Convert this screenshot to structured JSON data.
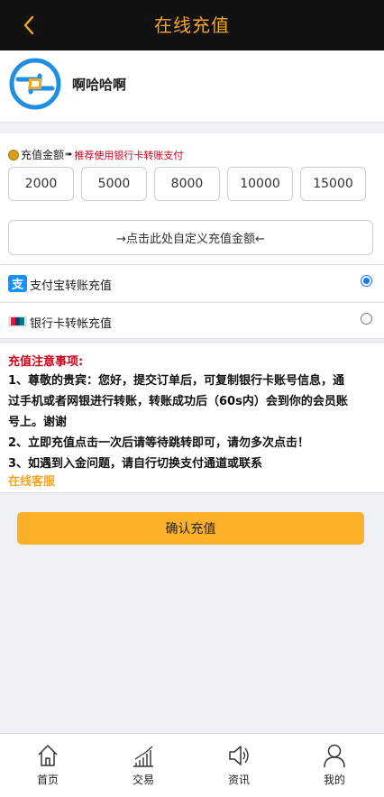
{
  "header": {
    "title": "在线充值"
  },
  "profile": {
    "username": "啊哈哈啊"
  },
  "amount": {
    "label": "充值金额",
    "hint": "推荐使用银行卡转账支付",
    "options": [
      "2000",
      "5000",
      "8000",
      "10000",
      "15000"
    ],
    "custom_label": "→点击此处自定义充值金额←"
  },
  "payment_methods": [
    {
      "label": "支付宝转账充值",
      "icon": "alipay-icon",
      "selected": true
    },
    {
      "label": "银行卡转帐充值",
      "icon": "unionpay-icon",
      "selected": false
    }
  ],
  "notice": {
    "title": "充值注意事项:",
    "line1": "1、尊敬的贵宾：您好，提交订单后，可复制银行卡账号信息，通",
    "line2": "过手机或者网银进行转账，转账成功后（60s内）会到你的会员账",
    "line3": "号上。谢谢",
    "line4": "2、立即充值点击一次后请等待跳转即可，请勿多次点击！",
    "line5": "3、如遇到入金问题，请自行切换支付通道或联系",
    "link": "在线客服"
  },
  "confirm_label": "确认充值",
  "tabs": [
    {
      "label": "首页",
      "icon": "home-icon"
    },
    {
      "label": "交易",
      "icon": "chart-icon"
    },
    {
      "label": "资讯",
      "icon": "speaker-icon"
    },
    {
      "label": "我的",
      "icon": "user-icon"
    }
  ],
  "colors": {
    "accent": "#f5a623",
    "header_bg": "#111111",
    "button": "#fbb02a",
    "warning": "#d0021b",
    "radio": "#1677ff"
  }
}
